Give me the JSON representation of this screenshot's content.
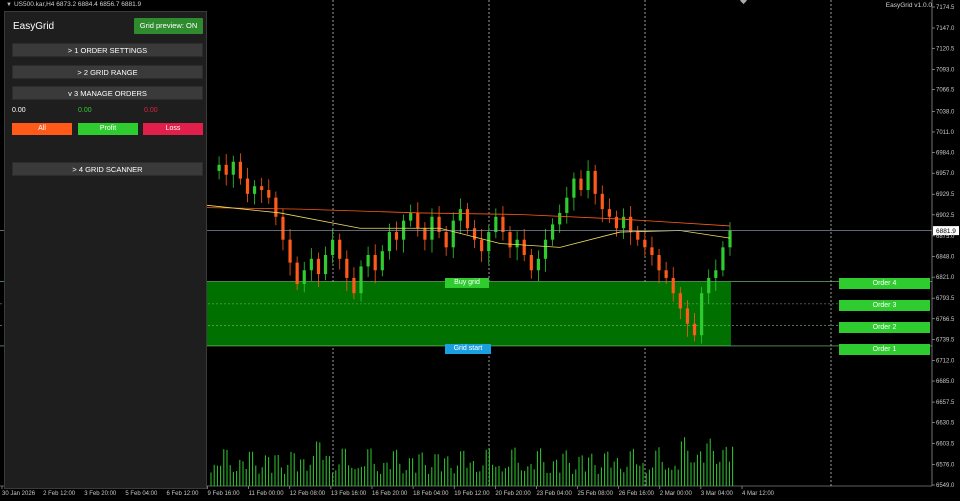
{
  "top_info": {
    "symbol_line": "US500.kar,H4  6873.2 6884.4 6856.7 6881.9",
    "indicator_label": "EasyGrid v1.0.0"
  },
  "panel": {
    "title": "EasyGrid",
    "preview_button": "Grid preview: ON",
    "sections": [
      {
        "label": ">  1 ORDER SETTINGS"
      },
      {
        "label": ">  2 GRID RANGE"
      },
      {
        "label": "v  3 MANAGE ORDERS"
      },
      {
        "label": ">  4 GRID SCANNER"
      }
    ],
    "values": {
      "all": "0.00",
      "profit": "0.00",
      "loss": "0.00"
    },
    "buttons": {
      "all": "All",
      "profit": "Profit",
      "loss": "Loss"
    }
  },
  "chart": {
    "labels": {
      "buy_grid": "Buy grid",
      "grid_start": "Grid start"
    },
    "orders": [
      "Order 4",
      "Order 3",
      "Order 2",
      "Order 1"
    ],
    "current_price": "6881.9",
    "price_ticks": [
      "7174.5",
      "7147.0",
      "7120.5",
      "7093.0",
      "7066.5",
      "7038.0",
      "7011.0",
      "6984.0",
      "6957.0",
      "6929.5",
      "6902.5",
      "6875.0",
      "6848.0",
      "6821.0",
      "6793.5",
      "6766.5",
      "6739.5",
      "6712.0",
      "6685.0",
      "6657.5",
      "6630.5",
      "6603.5",
      "6576.0",
      "6549.0"
    ],
    "time_ticks": [
      "30 Jan 2026",
      "2 Feb 12:00",
      "3 Feb 20:00",
      "5 Feb 04:00",
      "6 Feb 12:00",
      "9 Feb 16:00",
      "11 Feb 00:00",
      "12 Feb 08:00",
      "13 Feb 16:00",
      "16 Feb 20:00",
      "18 Feb 04:00",
      "19 Feb 12:00",
      "20 Feb 20:00",
      "23 Feb 04:00",
      "25 Feb 08:00",
      "26 Feb 16:00",
      "2 Mar 00:00",
      "3 Mar 04:00",
      "4 Mar 12:00"
    ],
    "colors": {
      "bull": "#2ecc2e",
      "bear": "#ff5a1a",
      "grid_fill": "#007000",
      "ma_slow": "#ff5a1a",
      "ma_fast": "#f0e060"
    }
  }
}
